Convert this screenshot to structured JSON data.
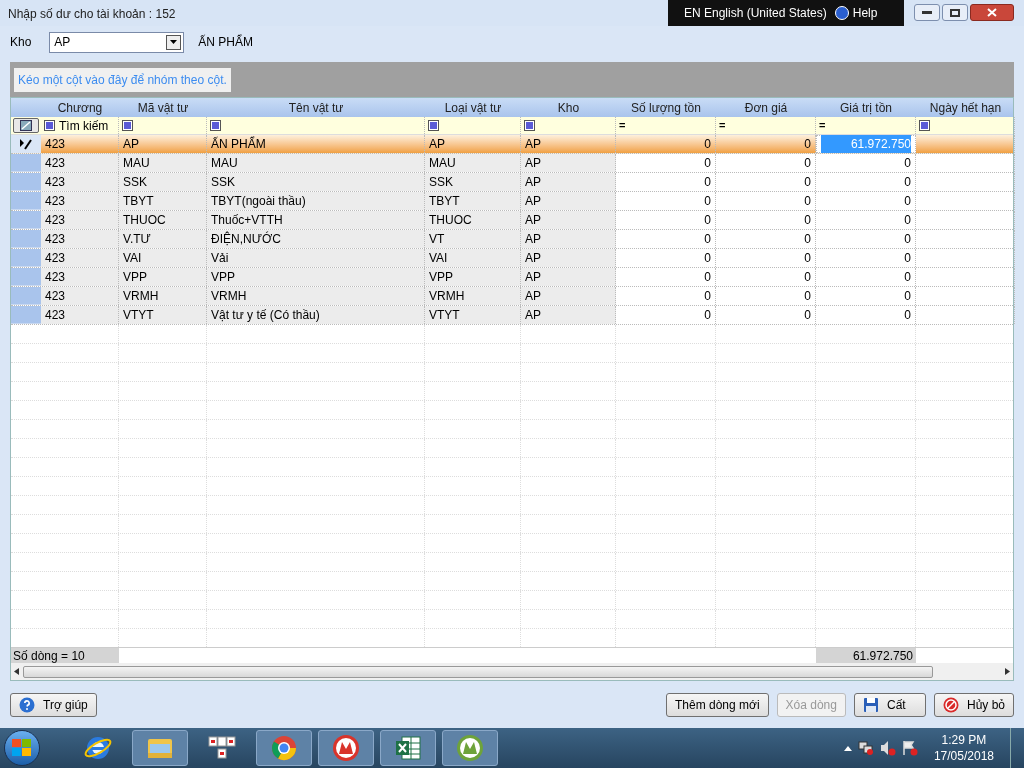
{
  "window": {
    "title": "Nhập số dư cho tài khoản : 152"
  },
  "language_bar": {
    "language": "EN English (United States)",
    "help": "Help"
  },
  "warehouse": {
    "label": "Kho",
    "value": "AP",
    "name": "ẤN PHẨM"
  },
  "group_panel": {
    "hint": "Kéo một cột vào đây để nhóm theo cột."
  },
  "table": {
    "columns": [
      {
        "title": "Chương",
        "kind": "text",
        "readonly": true,
        "filter_checkbox": true,
        "filter_text": "Tìm kiếm"
      },
      {
        "title": "Mã vật tư",
        "kind": "text",
        "readonly": true,
        "filter_checkbox": true
      },
      {
        "title": "Tên vật tư",
        "kind": "text",
        "readonly": true,
        "filter_checkbox": true
      },
      {
        "title": "Loại vật tư",
        "kind": "text",
        "readonly": true,
        "filter_checkbox": true
      },
      {
        "title": "Kho",
        "kind": "text",
        "readonly": true,
        "filter_checkbox": true
      },
      {
        "title": "Số lượng tồn",
        "kind": "number",
        "readonly": false,
        "filter_checkbox": false,
        "filter_operator": "="
      },
      {
        "title": "Đơn giá",
        "kind": "number",
        "readonly": false,
        "filter_checkbox": false,
        "filter_operator": "="
      },
      {
        "title": "Giá trị tồn",
        "kind": "number",
        "readonly": false,
        "filter_checkbox": false,
        "filter_operator": "="
      },
      {
        "title": "Ngày hết hạn",
        "kind": "text",
        "readonly": false,
        "filter_checkbox": true
      }
    ],
    "rows": [
      {
        "selected": true,
        "cells": [
          "423",
          "AP",
          "ẤN PHẨM",
          "AP",
          "AP",
          "0",
          "0",
          {
            "text": "61.972.750",
            "editing": true
          }
        ]
      },
      {
        "selected": false,
        "cells": [
          "423",
          "MAU",
          "MAU",
          "MAU",
          "AP",
          "0",
          "0",
          "0"
        ]
      },
      {
        "selected": false,
        "cells": [
          "423",
          "SSK",
          "SSK",
          "SSK",
          "AP",
          "0",
          "0",
          "0"
        ]
      },
      {
        "selected": false,
        "cells": [
          "423",
          "TBYT",
          "TBYT(ngoài thầu)",
          "TBYT",
          "AP",
          "0",
          "0",
          "0"
        ]
      },
      {
        "selected": false,
        "cells": [
          "423",
          "THUOC",
          "Thuốc+VTTH",
          "THUOC",
          "AP",
          "0",
          "0",
          "0"
        ]
      },
      {
        "selected": false,
        "cells": [
          "423",
          "V.TƯ",
          "ĐIỆN,NƯỚC",
          "VT",
          "AP",
          "0",
          "0",
          "0"
        ]
      },
      {
        "selected": false,
        "cells": [
          "423",
          "VAI",
          "Vải",
          "VAI",
          "AP",
          "0",
          "0",
          "0"
        ]
      },
      {
        "selected": false,
        "cells": [
          "423",
          "VPP",
          "VPP",
          "VPP",
          "AP",
          "0",
          "0",
          "0"
        ]
      },
      {
        "selected": false,
        "cells": [
          "423",
          "VRMH",
          "VRMH",
          "VRMH",
          "AP",
          "0",
          "0",
          "0"
        ]
      },
      {
        "selected": false,
        "cells": [
          "423",
          "VTYT",
          "Vật tư y tế (Có thầu)",
          "VTYT",
          "AP",
          "0",
          "0",
          "0"
        ]
      }
    ],
    "footer": {
      "row_count": "Số dòng = 10",
      "total": "61.972.750"
    }
  },
  "buttons": [
    {
      "label": "Trợ giúp",
      "kind": "help",
      "disabled": false
    },
    {
      "label": "Thêm dòng mới",
      "kind": "plain",
      "disabled": false
    },
    {
      "label": "Xóa dòng",
      "kind": "plain",
      "disabled": true
    },
    {
      "label": "Cất",
      "kind": "save",
      "disabled": false
    },
    {
      "label": "Hủy bỏ",
      "kind": "cancel",
      "disabled": false
    }
  ],
  "taskbar": {
    "apps": [
      {
        "kind": "ie",
        "open": false
      },
      {
        "kind": "folder",
        "open": true
      },
      {
        "kind": "keyboard",
        "open": false
      },
      {
        "kind": "chrome",
        "open": true
      },
      {
        "kind": "red-logo",
        "open": true
      },
      {
        "kind": "spreadsheet",
        "open": true
      },
      {
        "kind": "green-logo",
        "open": true
      }
    ],
    "time": "1:29 PM",
    "date": "17/05/2018"
  }
}
